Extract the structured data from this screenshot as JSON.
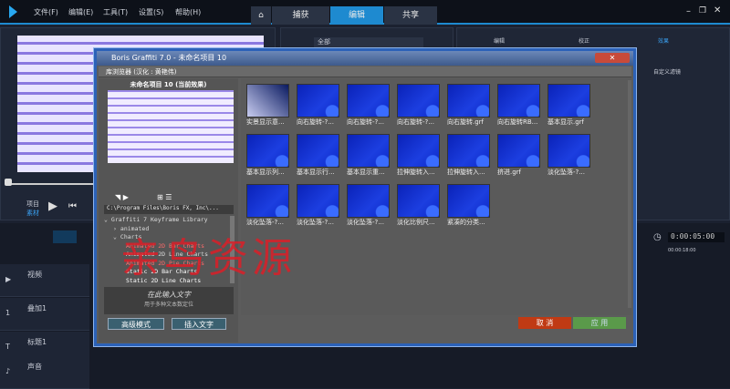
{
  "menu": [
    "文件(F)",
    "编辑(E)",
    "工具(T)",
    "设置(S)",
    "帮助(H)"
  ],
  "tabs": [
    "捕获",
    "编辑",
    "共享"
  ],
  "library": {
    "filter": "全部",
    "subtabs": [
      "编辑",
      "校正",
      "效果"
    ],
    "custom_filter": "自定义滤镜"
  },
  "player": {
    "project": "项目",
    "clip": "素材"
  },
  "dialog": {
    "title": "Boris Graffiti 7.0 - 未命名项目 10",
    "browser_label": "库浏览器 (汉化 : 黄艳伟)",
    "preview_title": "未命名项目 10 (当前效果)",
    "path": "C:\\Program Files\\Boris FX, Inc\\...",
    "tree": [
      {
        "label": "Graffiti 7 Keyframe Library",
        "color": "#dddddd",
        "indent": 0,
        "glyph": "⌄"
      },
      {
        "label": "animated",
        "color": "#dddddd",
        "indent": 1,
        "glyph": "›"
      },
      {
        "label": "Charts",
        "color": "#dddddd",
        "indent": 1,
        "glyph": "⌄"
      },
      {
        "label": "Animated 2D Bar Charts",
        "color": "#ff6b6b",
        "indent": 2,
        "glyph": ""
      },
      {
        "label": "Animated 2D Line Charts",
        "color": "#dddddd",
        "indent": 2,
        "glyph": ""
      },
      {
        "label": "Animated 2D Pie Charts",
        "color": "#ff6b6b",
        "indent": 2,
        "glyph": ""
      },
      {
        "label": "Static 2D Bar Charts",
        "color": "#ffffff",
        "indent": 2,
        "glyph": ""
      },
      {
        "label": "Static 2D Line Charts",
        "color": "#ffffff",
        "indent": 2,
        "glyph": ""
      }
    ],
    "text_input": "在此输入文字",
    "text_hint": "用于多种文本数定位",
    "advanced_button": "高级模式",
    "insert_text_button": "插入文字",
    "cancel_button": "取 消",
    "apply_button": "应 用",
    "thumbnails": [
      "实景显示意...",
      "向右旋转-?...",
      "向右旋转-?...",
      "向右旋转-?...",
      "向右旋转.grf",
      "向右旋转RB...",
      "基本显示.grf",
      "基本显示列...",
      "基本显示行...",
      "基本显示重...",
      "拉伸旋转入...",
      "拉伸旋转入...",
      "挤进.grf",
      "淡化坠落-?...",
      "淡化坠落-?...",
      "淡化坠落-?...",
      "淡化坠落-?...",
      "淡化比例尺...",
      "紧凑的分类..."
    ]
  },
  "timeline": {
    "timecode": "0:00:05:00",
    "ruler": "00:00:18:00",
    "tracks": [
      {
        "name": "视频",
        "icon": "▶"
      },
      {
        "name": "叠加1",
        "icon": "1"
      },
      {
        "name": "标题1",
        "icon": "T"
      },
      {
        "name": "声音",
        "icon": "♪"
      }
    ]
  },
  "watermark": "亲鸟资源"
}
